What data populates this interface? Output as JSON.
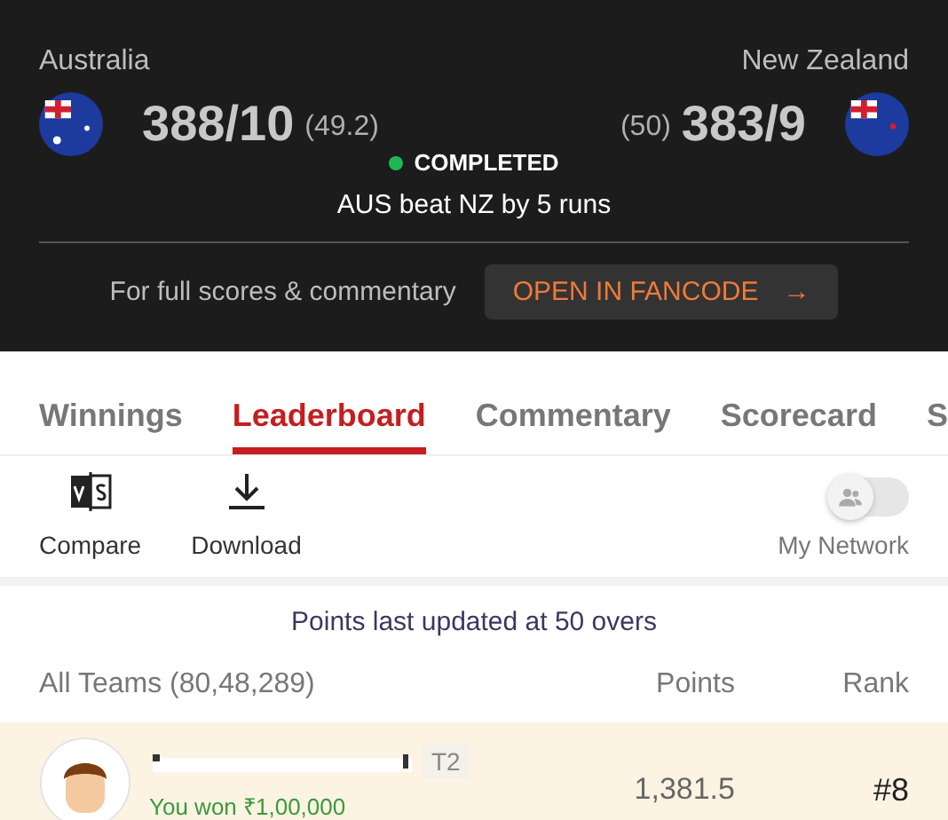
{
  "match": {
    "home": {
      "name": "Australia",
      "score": "388/10",
      "overs": "(49.2)"
    },
    "away": {
      "name": "New Zealand",
      "score": "383/9",
      "overs": "(50)"
    },
    "status": {
      "label": "COMPLETED",
      "color": "#1db954"
    },
    "result": "AUS beat NZ by 5 runs",
    "promo": {
      "text": "For full scores & commentary",
      "button": "OPEN IN FANCODE",
      "arrow": "→"
    }
  },
  "tabs": [
    {
      "label": "Winnings",
      "selected": false
    },
    {
      "label": "Leaderboard",
      "selected": true
    },
    {
      "label": "Commentary",
      "selected": false
    },
    {
      "label": "Scorecard",
      "selected": false
    },
    {
      "label": "S",
      "selected": false
    }
  ],
  "toolbar": {
    "compare": "Compare",
    "download": "Download",
    "network": {
      "label": "My Network",
      "on": false
    }
  },
  "updated": "Points last updated at 50 overs",
  "table": {
    "columns": [
      "All Teams (80,48,289)",
      "Points",
      "Rank"
    ],
    "rows": [
      {
        "team": "T2",
        "points": "1,381.5",
        "rank": "#8",
        "winnings": "You won ₹1,00,000",
        "highlighted": true
      }
    ]
  }
}
